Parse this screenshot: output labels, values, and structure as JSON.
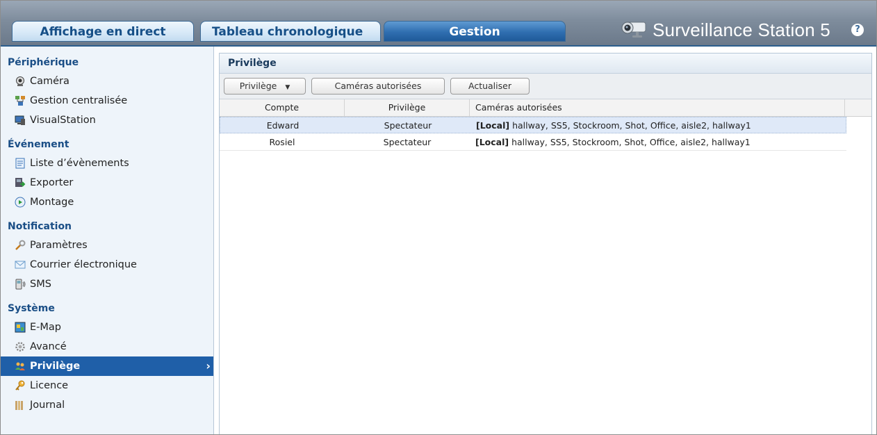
{
  "header": {
    "tabs": [
      {
        "label": "Affichage en direct",
        "active": false
      },
      {
        "label": "Tableau chronologique",
        "active": false
      },
      {
        "label": "Gestion",
        "active": true
      }
    ],
    "brand": "Surveillance Station 5",
    "help": "?"
  },
  "sidebar": {
    "sections": [
      {
        "title": "Périphérique",
        "items": [
          {
            "label": "Caméra",
            "icon": "camera-icon"
          },
          {
            "label": "Gestion centralisée",
            "icon": "network-icon"
          },
          {
            "label": "VisualStation",
            "icon": "visualstation-icon"
          }
        ]
      },
      {
        "title": "Événement",
        "items": [
          {
            "label": "Liste d’évènements",
            "icon": "event-list-icon"
          },
          {
            "label": "Exporter",
            "icon": "export-icon"
          },
          {
            "label": "Montage",
            "icon": "montage-icon"
          }
        ]
      },
      {
        "title": "Notification",
        "items": [
          {
            "label": "Paramètres",
            "icon": "wrench-icon"
          },
          {
            "label": "Courrier électronique",
            "icon": "mail-icon"
          },
          {
            "label": "SMS",
            "icon": "sms-icon"
          }
        ]
      },
      {
        "title": "Système",
        "items": [
          {
            "label": "E-Map",
            "icon": "map-icon"
          },
          {
            "label": "Avancé",
            "icon": "gear-icon"
          },
          {
            "label": "Privilège",
            "icon": "users-icon",
            "selected": true
          },
          {
            "label": "Licence",
            "icon": "key-icon"
          },
          {
            "label": "Journal",
            "icon": "log-icon"
          }
        ]
      }
    ]
  },
  "main": {
    "title": "Privilège",
    "toolbar": {
      "privilege_dropdown": "Privilège",
      "authorized_cameras_button": "Caméras autorisées",
      "refresh_button": "Actualiser"
    },
    "table": {
      "columns": [
        "Compte",
        "Privilège",
        "Caméras autorisées"
      ],
      "rows": [
        {
          "account": "Edward",
          "privilege": "Spectateur",
          "scope": "[Local]",
          "cameras": " hallway, SS5, Stockroom, Shot, Office, aisle2, hallway1",
          "selected": true
        },
        {
          "account": "Rosiel",
          "privilege": "Spectateur",
          "scope": "[Local]",
          "cameras": " hallway, SS5, Stockroom, Shot, Office, aisle2, hallway1",
          "selected": false
        }
      ]
    }
  },
  "colors": {
    "accent": "#1f5fa8",
    "section_title": "#1a4e86",
    "row_selected": "#dfe9f8",
    "header_gradient_top": "#9aa7b6"
  }
}
